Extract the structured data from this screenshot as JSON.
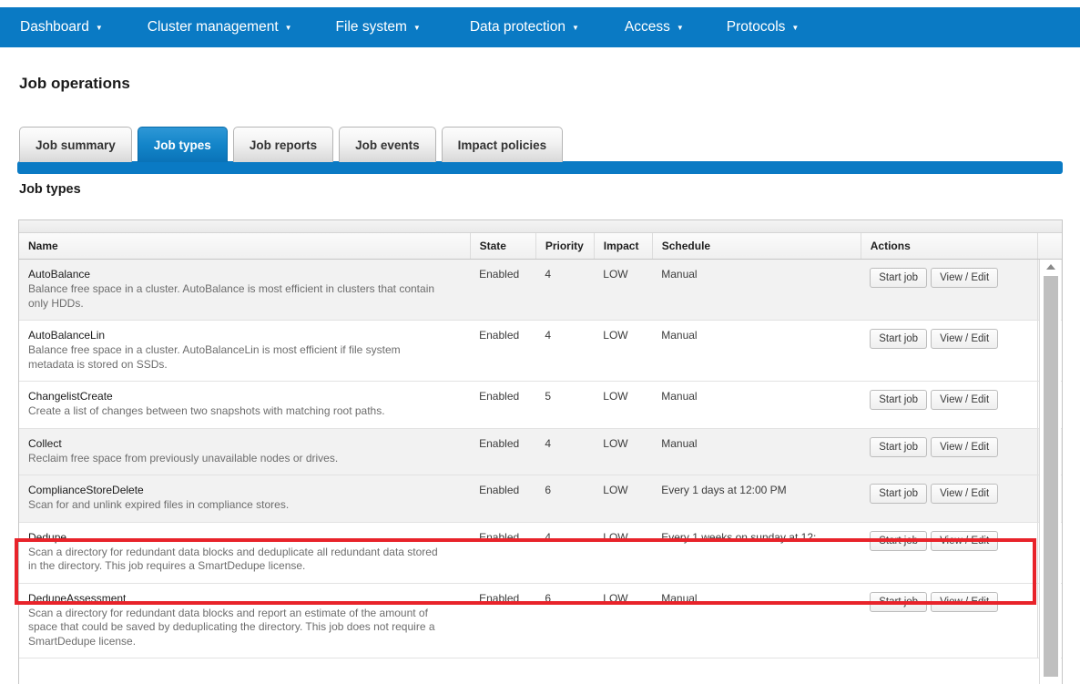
{
  "topnav": {
    "background": "#0a7ac4",
    "caret": "▼",
    "items": [
      {
        "label": "Dashboard",
        "icon": "chevron-down-icon"
      },
      {
        "label": "Cluster management",
        "icon": "chevron-down-icon"
      },
      {
        "label": "File system",
        "icon": "chevron-down-icon"
      },
      {
        "label": "Data protection",
        "icon": "chevron-down-icon"
      },
      {
        "label": "Access",
        "icon": "chevron-down-icon"
      },
      {
        "label": "Protocols",
        "icon": "chevron-down-icon"
      }
    ]
  },
  "page": {
    "title": "Job operations",
    "section_title": "Job types"
  },
  "tabs": [
    {
      "label": "Job summary",
      "active": false
    },
    {
      "label": "Job types",
      "active": true
    },
    {
      "label": "Job reports",
      "active": false
    },
    {
      "label": "Job events",
      "active": false
    },
    {
      "label": "Impact policies",
      "active": false
    }
  ],
  "table": {
    "headers": {
      "name": "Name",
      "state": "State",
      "priority": "Priority",
      "impact": "Impact",
      "schedule": "Schedule",
      "actions": "Actions"
    },
    "buttons": {
      "start_job": "Start job",
      "view_edit": "View / Edit"
    },
    "rows": [
      {
        "name": "AutoBalance",
        "description": "Balance free space in a cluster. AutoBalance is most efficient in clusters that contain only HDDs.",
        "state": "Enabled",
        "priority": "4",
        "impact": "LOW",
        "schedule": "Manual"
      },
      {
        "name": "AutoBalanceLin",
        "description": "Balance free space in a cluster. AutoBalanceLin is most efficient if file system metadata is stored on SSDs.",
        "state": "Enabled",
        "priority": "4",
        "impact": "LOW",
        "schedule": "Manual"
      },
      {
        "name": "ChangelistCreate",
        "description": "Create a list of changes between two snapshots with matching root paths.",
        "state": "Enabled",
        "priority": "5",
        "impact": "LOW",
        "schedule": "Manual"
      },
      {
        "name": "Collect",
        "description": "Reclaim free space from previously unavailable nodes or drives.",
        "state": "Enabled",
        "priority": "4",
        "impact": "LOW",
        "schedule": "Manual"
      },
      {
        "name": "ComplianceStoreDelete",
        "description": "Scan for and unlink expired files in compliance stores.",
        "state": "Enabled",
        "priority": "6",
        "impact": "LOW",
        "schedule": "Every 1 days at 12:00 PM"
      },
      {
        "name": "Dedupe",
        "description": "Scan a directory for redundant data blocks and deduplicate all redundant data stored in the directory. This job requires a SmartDedupe license.",
        "state": "Enabled",
        "priority": "4",
        "impact": "LOW",
        "schedule": "Every 1 weeks on sunday at 12:...",
        "highlighted": true
      },
      {
        "name": "DedupeAssessment",
        "description": "Scan a directory for redundant data blocks and report an estimate of the amount of space that could be saved by deduplicating the directory. This job does not require a SmartDedupe license.",
        "state": "Enabled",
        "priority": "6",
        "impact": "LOW",
        "schedule": "Manual"
      }
    ]
  },
  "scrollbar": {
    "up_arrow_icon": "scroll-up-arrow-icon"
  },
  "annotation": {
    "color": "#e8232a"
  }
}
